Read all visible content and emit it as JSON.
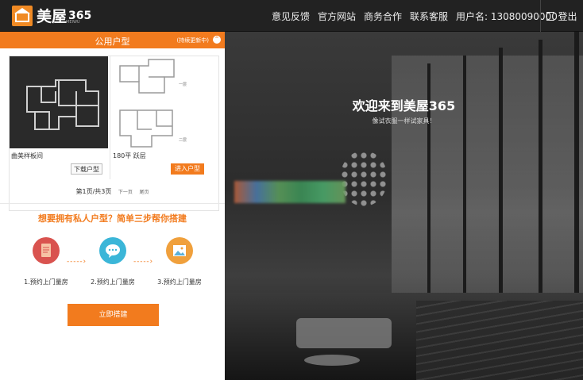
{
  "app": {
    "logo_text": "美屋",
    "logo_number": "365",
    "logo_sub": "MEIWU"
  },
  "nav": {
    "items": [
      "意见反馈",
      "官方网站",
      "商务合作",
      "联系客服"
    ],
    "username": "用户名: 13080090000",
    "logout": "登出"
  },
  "panel": {
    "title": "公用户型",
    "update_note": "(持续更新中)",
    "cards": [
      {
        "label": "曲美样板间",
        "button": "下载户型"
      },
      {
        "label": "180平 跃层",
        "button": "进入户型",
        "floor_labels": [
          "一层",
          "二层"
        ]
      }
    ],
    "pager": {
      "text": "第1页/共3页",
      "prev": "下一页",
      "last": "尾页"
    },
    "promo": "想要拥有私人户型？简单三步帮你搭建",
    "steps": [
      "1.预约上门量房",
      "2.预约上门量房",
      "3.预约上门量房"
    ],
    "cta": "立即搭建"
  },
  "hero": {
    "title": "欢迎来到美屋365",
    "subtitle": "像试衣服一样试家具！"
  },
  "colors": {
    "accent": "#f27b1e",
    "topbar": "#222222",
    "step1": "#d9534f",
    "step2": "#3bb6d8",
    "step3": "#f0a03c"
  },
  "icons": [
    "document-icon",
    "chat-bubble-icon",
    "image-icon",
    "logout-icon",
    "up-arrow-icon",
    "house-logo-icon"
  ]
}
